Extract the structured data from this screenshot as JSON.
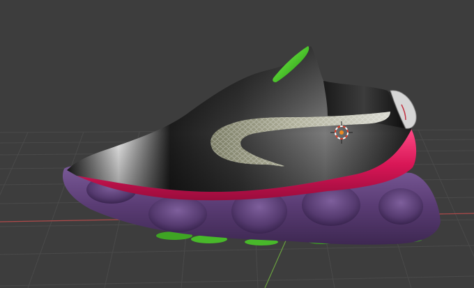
{
  "viewport": {
    "background_color": "#3d3d3d",
    "grid_color": "#4a4a4a",
    "x_axis_color": "#b04a4a",
    "y_axis_color": "#6aa040"
  },
  "scene": {
    "object": "sneaker-model",
    "colors": {
      "upper_black": "#141414",
      "upper_grey": "#6c6c6c",
      "swoosh_pattern": "#9a9a84",
      "collar_accent_green": "#3bd11c",
      "midsole_pink": "#e0185a",
      "outsole_purple": "#5f3f7a",
      "tread_green": "#48b82a"
    },
    "cursor": {
      "icon": "3d-cursor-icon",
      "ring_color_a": "#ffffff",
      "ring_color_b": "#e0402a",
      "center_color": "#f08a20"
    }
  }
}
